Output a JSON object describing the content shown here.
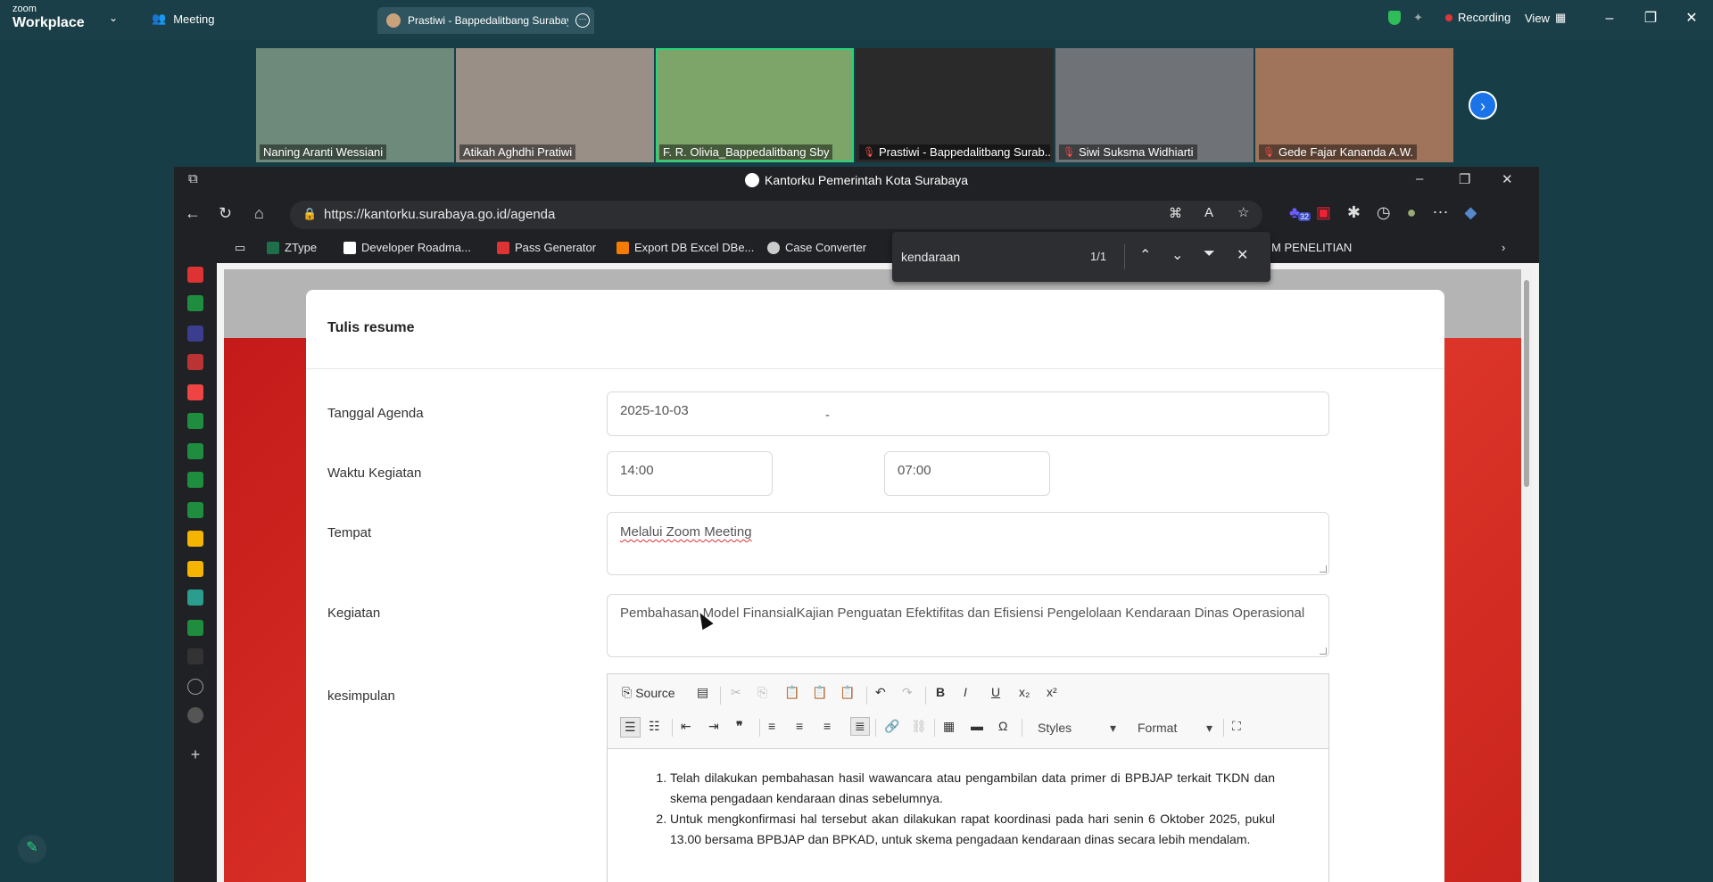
{
  "zoom": {
    "logo_top": "zoom",
    "logo_bottom": "Workplace",
    "meeting_tab": "Meeting",
    "share_tab": "Prastiwi - Bappedalitbang Surabaya",
    "recording": "Recording",
    "view": "View"
  },
  "participants": [
    {
      "name": "Naning Aranti Wessiani",
      "muted": false,
      "color": "#6d8a7a"
    },
    {
      "name": "Atikah Aghdhi Pratiwi",
      "muted": false,
      "color": "#9a8f87"
    },
    {
      "name": "F. R. Olivia_Bappedalitbang Sby",
      "muted": false,
      "color": "#7da56a"
    },
    {
      "name": "Prastiwi - Bappedalitbang Surab...",
      "muted": true,
      "color": "#2a2a2a"
    },
    {
      "name": "Siwi Suksma Widhiarti",
      "muted": true,
      "color": "#6f7276"
    },
    {
      "name": "Gede Fajar Kananda A.W.",
      "muted": true,
      "color": "#a0745a"
    }
  ],
  "browser": {
    "title": "Kantorku Pemerintah Kota Surabaya",
    "url": "https://kantorku.surabaya.go.id/agenda",
    "bookmarks": [
      "ZType",
      "Developer Roadma...",
      "Pass Generator",
      "Export DB Excel DBe...",
      "Case Converter",
      "M PENELITIAN"
    ],
    "find_query": "kendaraan",
    "find_count": "1/1",
    "badge_count": "32"
  },
  "form": {
    "title": "Tulis resume",
    "labels": {
      "tanggal": "Tanggal Agenda",
      "waktu": "Waktu Kegiatan",
      "tempat": "Tempat",
      "kegiatan": "Kegiatan",
      "kesimpulan": "kesimpulan"
    },
    "values": {
      "tanggal": "2025-10-03",
      "waktu_mulai": "14:00",
      "waktu_selesai": "07:00",
      "separator": "-",
      "tempat": "Melalui Zoom Meeting",
      "kegiatan": "Pembahasan Model FinansialKajian Penguatan Efektifitas dan Efisiensi Pengelolaan Kendaraan Dinas Operasional"
    }
  },
  "editor": {
    "source_label": "Source",
    "styles_label": "Styles",
    "format_label": "Format",
    "items": [
      "Telah dilakukan pembahasan hasil wawancara atau pengambilan data primer di BPBJAP terkait TKDN dan skema pengadaan kendaraan dinas sebelumnya.",
      "Untuk mengkonfirmasi hal tersebut akan dilakukan rapat koordinasi pada hari senin 6 Oktober 2025, pukul 13.00 bersama BPBJAP dan BPKAD, untuk skema pengadaan kendaraan dinas secara lebih mendalam."
    ]
  },
  "colors": {
    "zoom_bg": "#1b3f48",
    "page_red": "#d42a22",
    "active_tile": "#2ad47b",
    "recording_dot": "#e0363a"
  }
}
